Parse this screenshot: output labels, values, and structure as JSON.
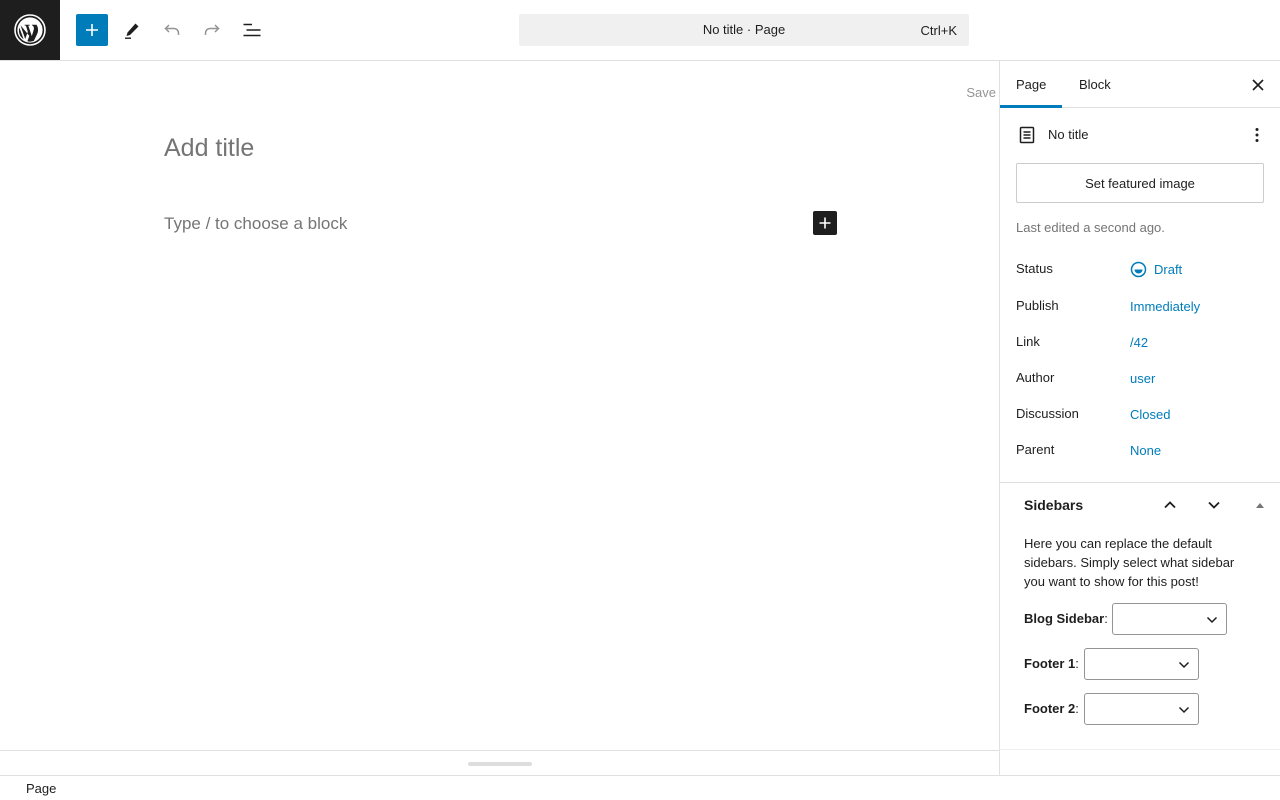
{
  "header": {
    "command_title": "No title · Page",
    "command_shortcut": "Ctrl+K"
  },
  "icons": {
    "logo": "wordpress-logo-icon",
    "add": "plus-icon",
    "edit": "pencil-icon",
    "undo": "undo-icon",
    "redo": "redo-icon",
    "list_view": "list-view-icon",
    "close": "close-icon",
    "document": "document-icon",
    "menu": "vertical-ellipsis-icon",
    "draft": "draft-status-icon",
    "chevron_up": "chevron-up-icon",
    "chevron_down": "chevron-down-icon",
    "toggle": "triangle-up-icon"
  },
  "editor": {
    "save_label": "Save",
    "title_placeholder": "Add title",
    "block_placeholder": "Type / to choose a block"
  },
  "footer": {
    "breadcrumb": "Page"
  },
  "sidebar": {
    "tabs": [
      {
        "label": "Page",
        "active": true
      },
      {
        "label": "Block",
        "active": false
      }
    ],
    "doc_title": "No title",
    "featured_image_label": "Set featured image",
    "last_edited": "Last edited a second ago.",
    "properties": [
      {
        "label": "Status",
        "value": "Draft"
      },
      {
        "label": "Publish",
        "value": "Immediately"
      },
      {
        "label": "Link",
        "value": "/42"
      },
      {
        "label": "Author",
        "value": "user"
      },
      {
        "label": "Discussion",
        "value": "Closed"
      },
      {
        "label": "Parent",
        "value": "None"
      }
    ],
    "metabox": {
      "title": "Sidebars",
      "description": "Here you can replace the default sidebars. Simply select what sidebar you want to show for this post!",
      "selects": [
        {
          "label": "Blog Sidebar",
          "value": ""
        },
        {
          "label": "Footer 1",
          "value": ""
        },
        {
          "label": "Footer 2",
          "value": ""
        }
      ]
    }
  },
  "colors": {
    "accent": "#007cba",
    "dark": "#1e1e1e",
    "muted": "#757575"
  }
}
